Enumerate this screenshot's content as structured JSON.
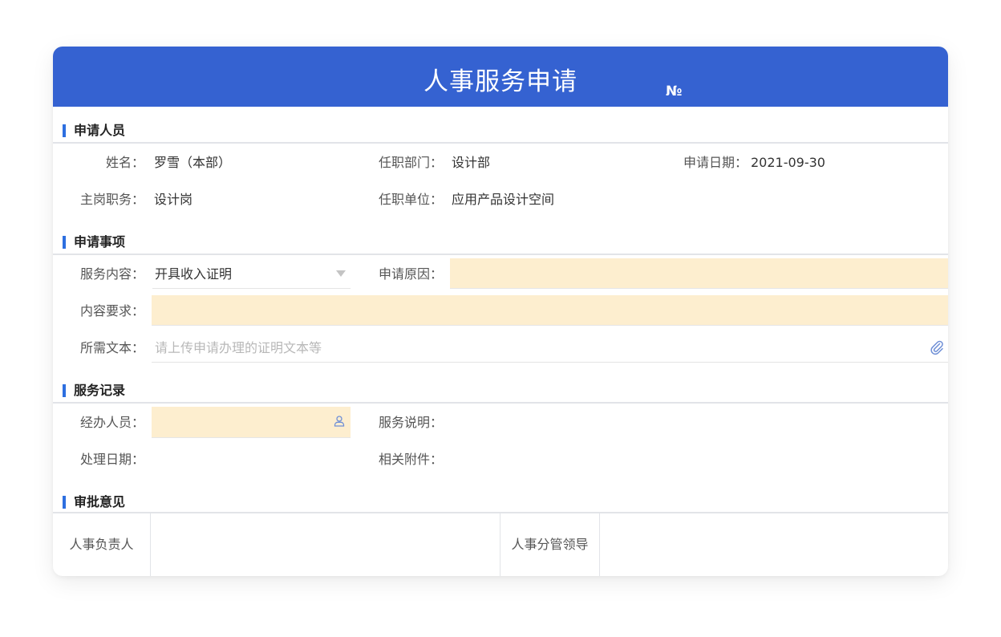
{
  "header": {
    "title": "人事服务申请",
    "number_label": "№"
  },
  "sections": {
    "applicant": "申请人员",
    "matter": "申请事项",
    "record": "服务记录",
    "approval": "审批意见"
  },
  "applicant": {
    "name_label": "姓名：",
    "name_value": "罗雪（本部）",
    "dept_label": "任职部门：",
    "dept_value": "设计部",
    "date_label": "申请日期：",
    "date_value": "2021-09-30",
    "post_label": "主岗职务：",
    "post_value": "设计岗",
    "unit_label": "任职单位：",
    "unit_value": "应用产品设计空间"
  },
  "matter": {
    "service_label": "服务内容：",
    "service_value": "开具收入证明",
    "reason_label": "申请原因：",
    "reason_value": "",
    "requirement_label": "内容要求：",
    "requirement_value": "",
    "document_label": "所需文本：",
    "document_placeholder": "请上传申请办理的证明文本等"
  },
  "record": {
    "handler_label": "经办人员：",
    "handler_value": "",
    "desc_label": "服务说明：",
    "date_label": "处理日期：",
    "attachment_label": "相关附件："
  },
  "approval": {
    "hr_head_label": "人事负责人",
    "hr_leader_label": "人事分管领导"
  },
  "icons": {
    "dropdown": "chevron-down-icon",
    "attachment": "paperclip-icon",
    "user_picker": "user-icon"
  },
  "colors": {
    "header_bg": "#3562d1",
    "accent_bar": "#2d6fe0",
    "required_field_bg": "#fdeecf"
  }
}
